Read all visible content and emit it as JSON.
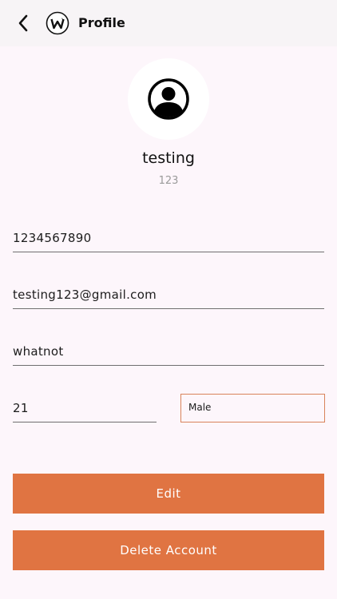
{
  "header": {
    "title": "Profile",
    "back_icon": "chevron-left-icon",
    "logo_icon": "w-logo-icon"
  },
  "profile": {
    "avatar_icon": "user-circle-icon",
    "name": "testing",
    "subtitle": "123"
  },
  "form": {
    "phone": "1234567890",
    "email": "testing123@gmail.com",
    "company": "whatnot",
    "age": "21",
    "gender": "Male"
  },
  "actions": {
    "edit_label": "Edit",
    "delete_label": "Delete Account"
  },
  "colors": {
    "accent": "#e07442",
    "background": "#fdf6fb",
    "header_bg": "#f7f4f6"
  }
}
